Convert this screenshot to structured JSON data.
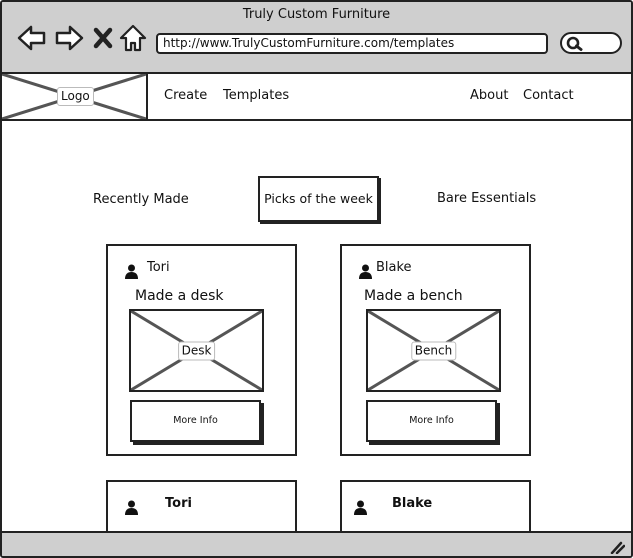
{
  "browser": {
    "title": "Truly Custom Furniture",
    "url": "http://www.TrulyCustomFurniture.com/templates"
  },
  "site_nav": {
    "logo": "Logo",
    "links": [
      "Create",
      "Templates",
      "About",
      "Contact"
    ]
  },
  "tabs": {
    "recent": "Recently Made",
    "picks": "Picks of the week",
    "essentials": "Bare Essentials"
  },
  "cards": [
    {
      "user": "Tori",
      "caption": "Made a desk",
      "image_label": "Desk",
      "button": "More Info"
    },
    {
      "user": "Blake",
      "caption": "Made a bench",
      "image_label": "Bench",
      "button": "More Info"
    }
  ],
  "mini_cards": [
    {
      "user": "Tori"
    },
    {
      "user": "Blake"
    }
  ],
  "icons": [
    "back-arrow-icon",
    "forward-arrow-icon",
    "close-x-icon",
    "home-icon",
    "search-icon",
    "user-icon",
    "resize-grip-icon"
  ]
}
